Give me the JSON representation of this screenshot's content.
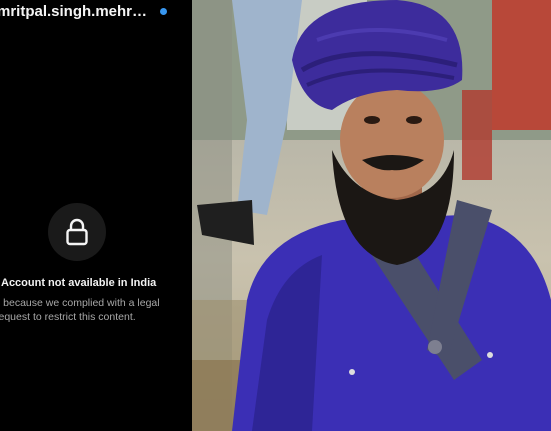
{
  "profile": {
    "username": "mritpal.singh.mehr…",
    "verified_color": "#3897f0"
  },
  "restriction_notice": {
    "icon": "lock-icon",
    "title": "Account not available in India",
    "body_line1": "s because we complied with a legal",
    "body_line2": "request to restrict this content."
  }
}
